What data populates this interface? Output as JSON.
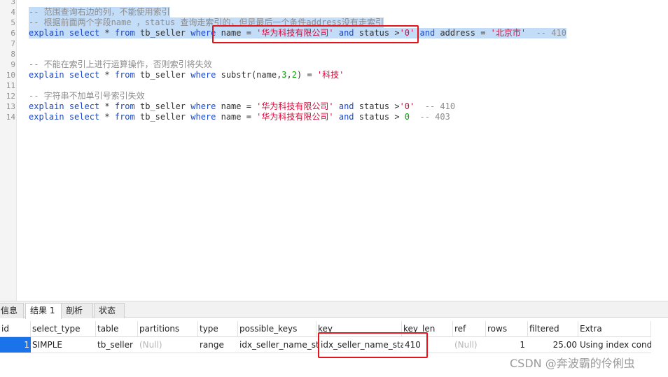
{
  "editor": {
    "lines": [
      {
        "num": "3",
        "text": ""
      },
      {
        "num": "4",
        "text": "-- 范围查询右边的列，不能使用索引"
      },
      {
        "num": "5",
        "text": "-- 根据前面两个字段name ，status 查询走索引的，但是最后一个条件address没有走索引"
      },
      {
        "num": "6",
        "parts": [
          "explain",
          " ",
          "select",
          " * ",
          "from",
          " tb_seller ",
          "where",
          " name = ",
          "'华为科技有限公司'",
          " ",
          "and",
          " status >",
          "'0'",
          " ",
          "and",
          " address = ",
          "'北京市'",
          "  -- 410"
        ]
      },
      {
        "num": "7",
        "text": ""
      },
      {
        "num": "8",
        "text": ""
      },
      {
        "num": "9",
        "text": "-- 不能在索引上进行运算操作，否则索引将失效"
      },
      {
        "num": "10",
        "parts": [
          "explain",
          " ",
          "select",
          " * ",
          "from",
          " tb_seller ",
          "where",
          " substr(name,",
          "3",
          ",",
          "2",
          ") = ",
          "'科技'"
        ]
      },
      {
        "num": "11",
        "text": ""
      },
      {
        "num": "12",
        "text": "-- 字符串不加单引号索引失效"
      },
      {
        "num": "13",
        "parts": [
          "explain",
          " ",
          "select",
          " * ",
          "from",
          " tb_seller ",
          "where",
          " name = ",
          "'华为科技有限公司'",
          " ",
          "and",
          " status >",
          "'0'",
          "  -- 410"
        ]
      },
      {
        "num": "14",
        "parts": [
          "explain",
          " ",
          "select",
          " * ",
          "from",
          " tb_seller ",
          "where",
          " name = ",
          "'华为科技有限公司'",
          " ",
          "and",
          " status > ",
          "0",
          "  -- 403"
        ]
      }
    ]
  },
  "tabs": [
    "信息",
    "结果 1",
    "剖析",
    "状态"
  ],
  "result": {
    "columns": [
      "id",
      "select_type",
      "table",
      "partitions",
      "type",
      "possible_keys",
      "key",
      "key_len",
      "ref",
      "rows",
      "filtered",
      "Extra"
    ],
    "row": [
      "1",
      "SIMPLE",
      "tb_seller",
      "(Null)",
      "range",
      "idx_seller_name_sta",
      "idx_seller_name_sta_a",
      "410",
      "(Null)",
      "1",
      "25.00",
      "Using index cond"
    ]
  },
  "watermark": "CSDN @奔波霸的伶俐虫",
  "colors": {
    "keyword": "#1b49c9",
    "string": "#d60b3c",
    "number": "#06a306",
    "comment": "#8c8c8c",
    "selection": "#c3dcf7",
    "highlight_box": "#e3151b"
  }
}
